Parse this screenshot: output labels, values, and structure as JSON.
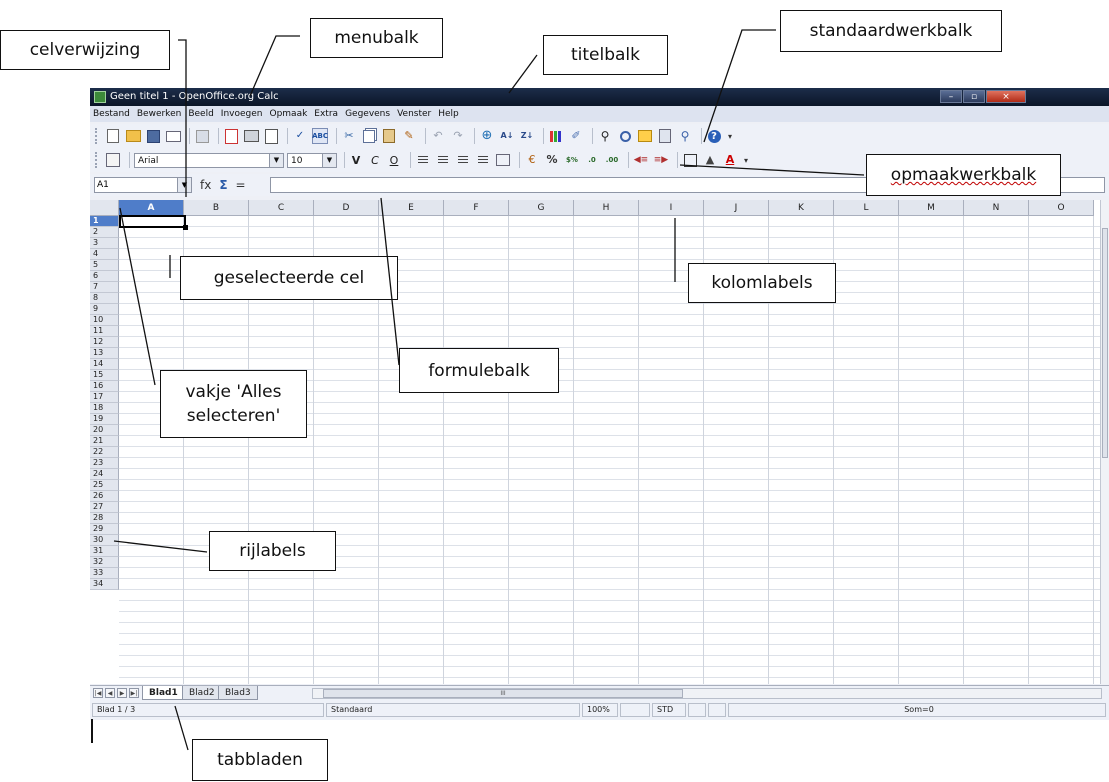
{
  "window": {
    "title": "Geen titel 1 - OpenOffice.org Calc",
    "controls": [
      "–",
      "▫",
      "×"
    ]
  },
  "menubar": {
    "items": [
      "Bestand",
      "Bewerken",
      "Beeld",
      "Invoegen",
      "Opmaak",
      "Extra",
      "Gegevens",
      "Venster",
      "Help"
    ]
  },
  "standard_toolbar": {
    "icons": [
      "new-icon",
      "open-icon",
      "save-icon",
      "mail-icon",
      "edit-file-icon",
      "export-pdf-icon",
      "print-icon",
      "page-preview-icon",
      "spellcheck-icon",
      "autospellcheck-icon",
      "cut-icon",
      "copy-icon",
      "paste-icon",
      "clone-format-icon",
      "undo-icon",
      "redo-icon",
      "hyperlink-icon",
      "sort-ascending-icon",
      "sort-descending-icon",
      "chart-icon",
      "draw-functions-icon",
      "find-icon",
      "navigator-icon",
      "gallery-icon",
      "data-sources-icon",
      "zoom-icon",
      "help-icon"
    ],
    "autospell_glyph": "ABC"
  },
  "format_toolbar": {
    "font_name": "Arial",
    "font_size": "10",
    "bold_glyph": "V",
    "italic_glyph": "C",
    "underline_glyph": "O",
    "percent_glyph": "%"
  },
  "formula_bar": {
    "cell_reference": "A1",
    "function_wizard_glyph": "fx",
    "sum_glyph": "Σ",
    "equals_glyph": "=",
    "formula_value": ""
  },
  "grid": {
    "columns": [
      "A",
      "B",
      "C",
      "D",
      "E",
      "F",
      "G",
      "H",
      "I",
      "J",
      "K",
      "L",
      "M",
      "N",
      "O"
    ],
    "rows": [
      "1",
      "2",
      "3",
      "4",
      "5",
      "6",
      "7",
      "8",
      "9",
      "10",
      "11",
      "12",
      "13",
      "14",
      "15",
      "16",
      "17",
      "18",
      "19",
      "20",
      "21",
      "22",
      "23",
      "24",
      "25",
      "26",
      "27",
      "28",
      "29",
      "30",
      "31",
      "32",
      "33",
      "34"
    ],
    "selected_cell": "A1"
  },
  "sheet_tabs": {
    "tabs": [
      "Blad1",
      "Blad2",
      "Blad3"
    ],
    "active": "Blad1",
    "scroll_glyph": "III"
  },
  "statusbar": {
    "sheet": "Blad 1 / 3",
    "page_style": "Standaard",
    "zoom": "100%",
    "selection_mode": "STD",
    "sum": "Som=0"
  },
  "annotations": {
    "celverwijzing": "celverwijzing",
    "menubalk": "menubalk",
    "titelbalk": "titelbalk",
    "standaardwerkbalk": "standaardwerkbalk",
    "opmaakwerkbalk": "opmaakwerkbalk",
    "geselecteerde_cel": "geselecteerde cel",
    "kolomlabels": "kolomlabels",
    "formulebalk": "formulebalk",
    "alles_selecteren": "vakje 'Alles selecteren'",
    "rijlabels": "rijlabels",
    "tabbladen": "tabbladen"
  }
}
